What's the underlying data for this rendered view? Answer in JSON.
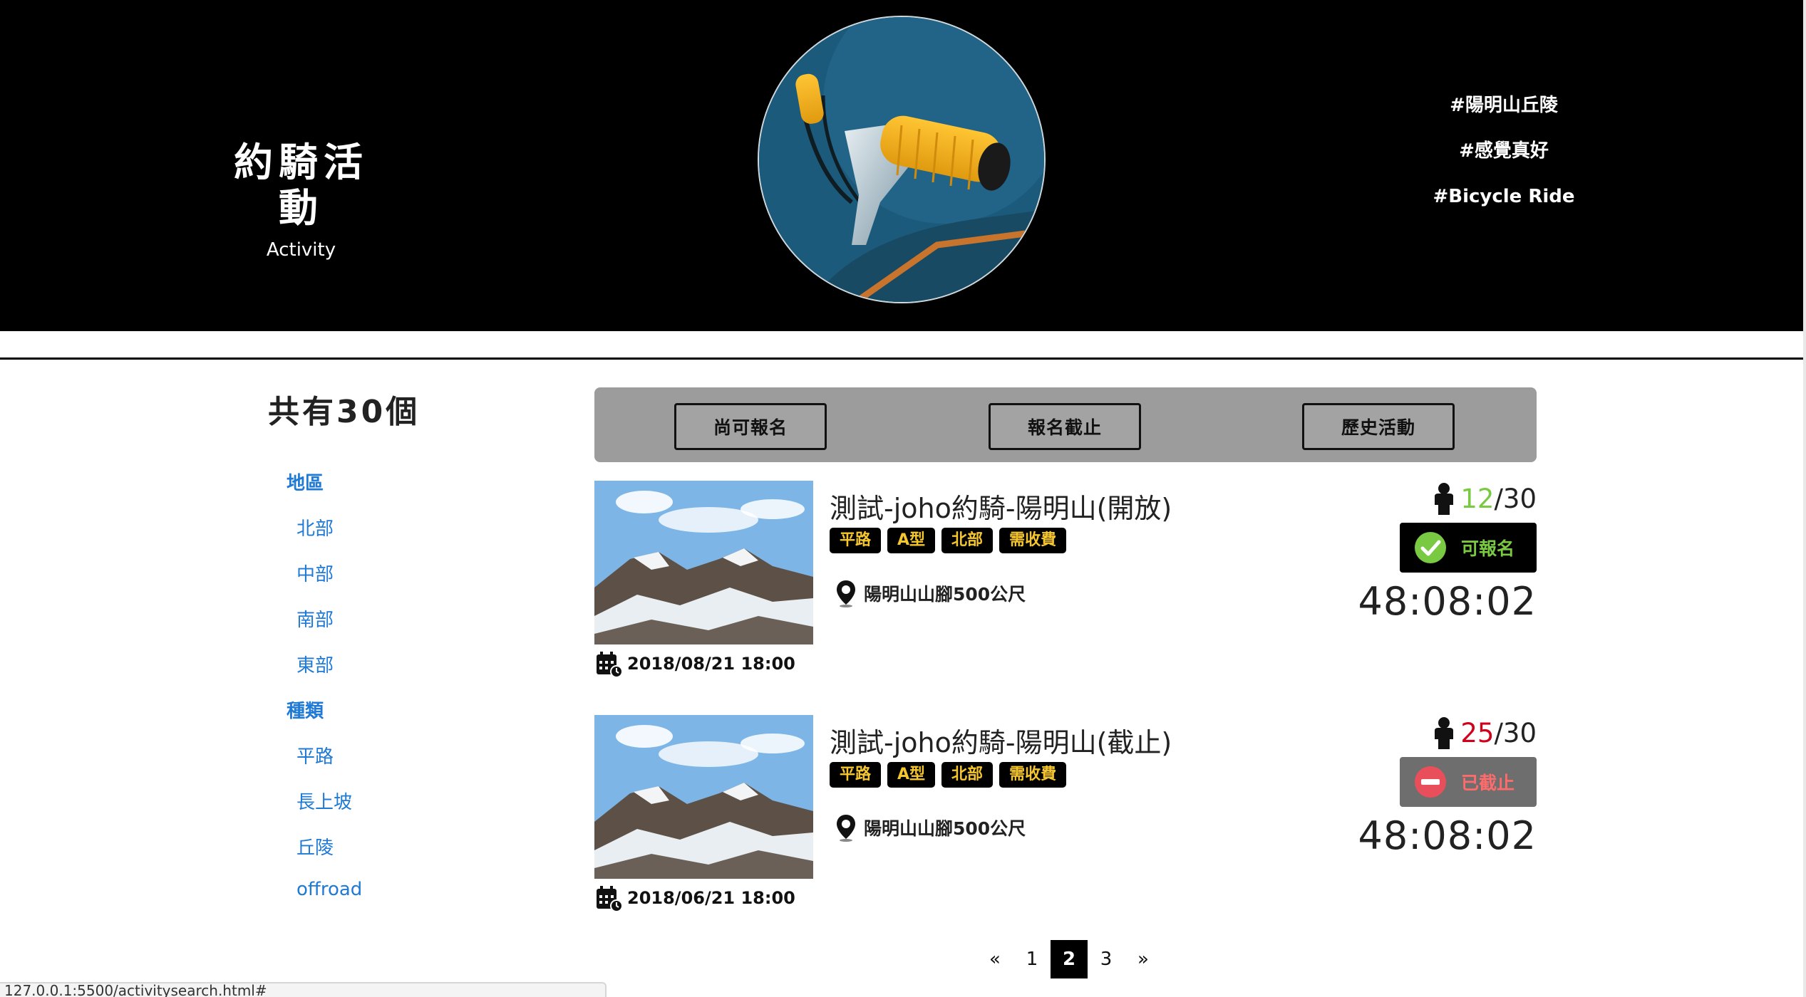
{
  "header": {
    "title_zh": "約騎活動",
    "title_en": "Activity",
    "hashtags": [
      "#陽明山丘陵",
      "#感覺真好",
      "#Bicycle Ride"
    ]
  },
  "sidebar": {
    "count_text": "共有30個",
    "groups": [
      {
        "label": "地區",
        "items": [
          "北部",
          "中部",
          "南部",
          "東部"
        ]
      },
      {
        "label": "種類",
        "items": [
          "平路",
          "長上坡",
          "丘陵",
          "offroad"
        ]
      }
    ]
  },
  "filters": [
    "尚可報名",
    "報名截止",
    "歷史活動"
  ],
  "activities": [
    {
      "title": "測試-joho約騎-陽明山(開放)",
      "tags": [
        "平路",
        "A型",
        "北部",
        "需收費"
      ],
      "location": "陽明山山腳500公尺",
      "date": "2018/08/21 18:00",
      "joined": "12",
      "total": "/30",
      "joined_color": "#7ac943",
      "status": "可報名",
      "status_icon": "check-icon",
      "status_bg": "#000000",
      "status_color": "#7ac943",
      "timer": "48:08:02"
    },
    {
      "title": "測試-joho約騎-陽明山(截止)",
      "tags": [
        "平路",
        "A型",
        "北部",
        "需收費"
      ],
      "location": "陽明山山腳500公尺",
      "date": "2018/06/21 18:00",
      "joined": "25",
      "total": "/30",
      "joined_color": "#d0021b",
      "status": "已截止",
      "status_icon": "no-entry-icon",
      "status_bg": "#6e6e6e",
      "status_color": "#ff6b6b",
      "timer": "48:08:02"
    }
  ],
  "pagination": {
    "prev": "«",
    "pages": [
      "1",
      "2",
      "3"
    ],
    "current": "2",
    "next": "»"
  },
  "status_url": "127.0.0.1:5500/activitysearch.html#"
}
